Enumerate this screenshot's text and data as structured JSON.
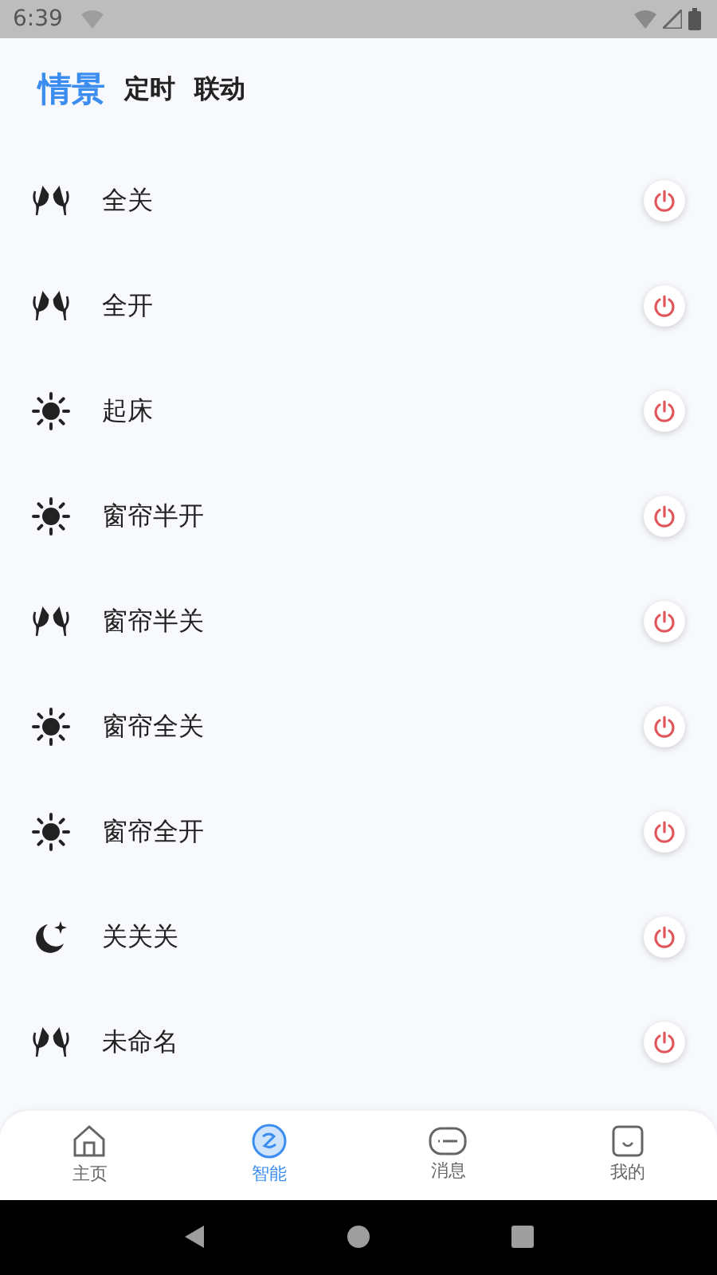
{
  "status_bar": {
    "time": "6:39"
  },
  "tabs": [
    {
      "label": "情景",
      "selected": true
    },
    {
      "label": "定时",
      "selected": false
    },
    {
      "label": "联动",
      "selected": false
    }
  ],
  "scenes": [
    {
      "kind": "cheers",
      "name": "全关"
    },
    {
      "kind": "cheers",
      "name": "全开"
    },
    {
      "kind": "sun",
      "name": "起床"
    },
    {
      "kind": "sun",
      "name": "窗帘半开"
    },
    {
      "kind": "cheers",
      "name": "窗帘半关"
    },
    {
      "kind": "sun",
      "name": "窗帘全关"
    },
    {
      "kind": "sun",
      "name": "窗帘全开"
    },
    {
      "kind": "moon",
      "name": "关关关"
    },
    {
      "kind": "cheers",
      "name": "未命名"
    }
  ],
  "bottom_nav": [
    {
      "label": "主页",
      "selected": false
    },
    {
      "label": "智能",
      "selected": true
    },
    {
      "label": "消息",
      "selected": false
    },
    {
      "label": "我的",
      "selected": false
    }
  ]
}
